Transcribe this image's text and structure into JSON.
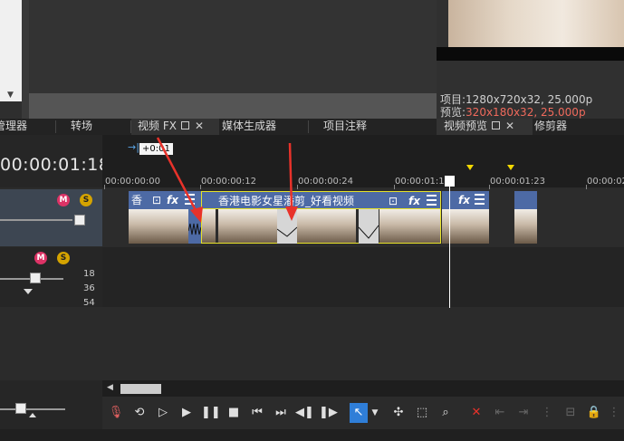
{
  "preview": {
    "project_label": "项目:",
    "project_value": "1280x720x32, 25.000p",
    "preview_label": "预览:",
    "preview_value": "320x180x32, 25.000p"
  },
  "tabs": [
    {
      "label": "管理器"
    },
    {
      "label": "转场"
    },
    {
      "label": "视频 FX",
      "active": true
    },
    {
      "label": "媒体生成器"
    },
    {
      "label": "项目注释"
    },
    {
      "label": "视频预览"
    },
    {
      "label": "修剪器"
    }
  ],
  "timeline": {
    "current_time": "00:00:01:18",
    "offset_badge": "+0:01",
    "ruler_ticks": [
      "00:00:00:00",
      "00:00:00:12",
      "00:00:00:24",
      "00:00:01:10",
      "00:00:01:23",
      "00:00:02"
    ],
    "db_marks": [
      "18",
      "36",
      "54"
    ]
  },
  "clips": [
    {
      "title": "香"
    },
    {
      "title": "香港电影女星潘剪_好看视频"
    }
  ],
  "track_buttons": {
    "mute": "M",
    "solo": "S"
  },
  "icons": {
    "fx": "fx",
    "menu": "menu-icon",
    "mute": "mute-icon",
    "solo": "solo-icon"
  },
  "colors": {
    "accent_blue": "#2f7ed8",
    "clip_header": "#4d6aa5",
    "preview_red": "#f06a5c",
    "annotation_red": "#e8322a"
  }
}
